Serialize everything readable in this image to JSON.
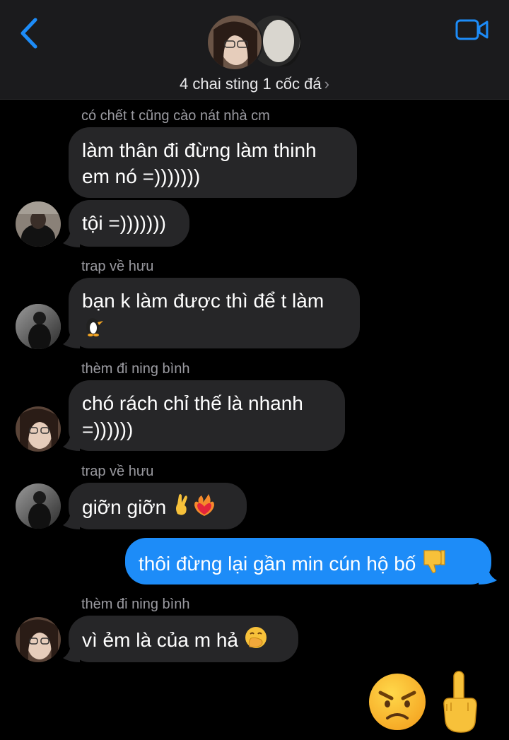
{
  "header": {
    "group_name": "4 chai sting 1 cốc đá",
    "chevron": "›",
    "back_icon": "chevron-left-icon",
    "video_icon": "video-camera-icon"
  },
  "colors": {
    "header_bg": "#1b1b1d",
    "incoming_bubble": "#262628",
    "outgoing_bubble": "#1d8cf8",
    "accent": "#1d8cf8"
  },
  "messages": [
    {
      "sender": "có chết t cũng cào nát nhà cm",
      "text": "làm thân đi đừng làm thinh em nó =)))))))"
    },
    {
      "text": "tội =)))))))"
    },
    {
      "sender": "trap về hưu",
      "text": "bạn k làm được thì để t làm",
      "emoji": "penguin-icon"
    },
    {
      "sender": "thèm đi ning bình",
      "text": "chó rách chỉ thế là nhanh =))))))"
    },
    {
      "sender": "trap về hưu",
      "text": "giỡn giỡn",
      "emoji": "crossed-fingers-and-heart-on-fire-icon"
    },
    {
      "outgoing": true,
      "text": "thôi đừng lại gần min cún hộ bố",
      "emoji": "thumbs-down-icon"
    },
    {
      "sender": "thèm đi ning bình",
      "text": "vì ẻm là của m hả",
      "emoji": "hand-over-mouth-icon"
    }
  ],
  "big_emojis": [
    "angry-face-icon",
    "middle-finger-icon"
  ]
}
